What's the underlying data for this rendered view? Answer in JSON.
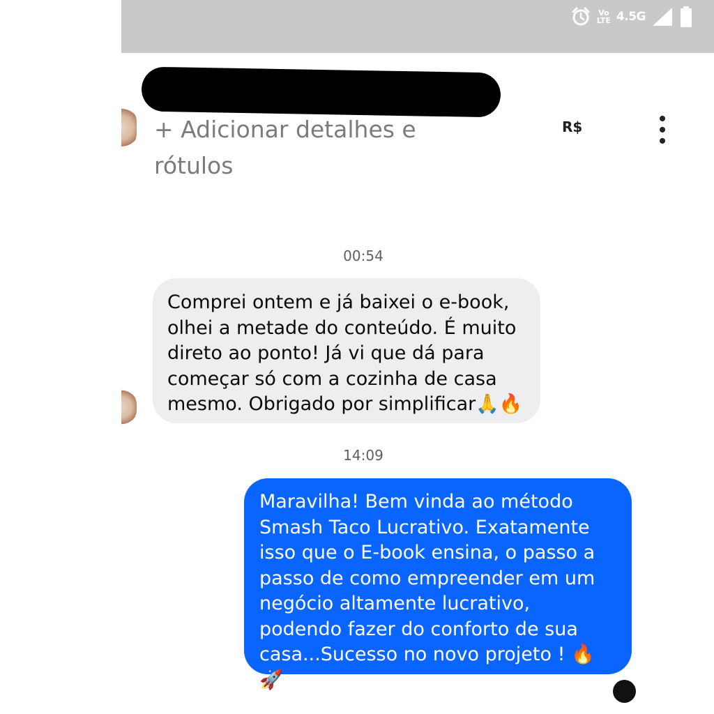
{
  "status_bar": {
    "network": "4.5G",
    "volte": "Vo\nLTE",
    "icons": [
      "alarm-icon",
      "volte-icon",
      "signal-icon",
      "battery-icon"
    ]
  },
  "header": {
    "add_details": "+ Adicionar detalhes e\nrótulos",
    "currency_button": "R$",
    "menu_icon": "kebab-menu-icon"
  },
  "messages": [
    {
      "time": "00:54",
      "direction": "incoming",
      "text": "Comprei ontem e já baixei o e-book,\nolhei a metade do conteúdo. É muito\ndireto ao ponto! Já vi que dá para\ncomeçar só com a cozinha de casa\nmesmo. Obrigado por simplificar🙏🔥"
    },
    {
      "time": "14:09",
      "direction": "outgoing",
      "text": "Maravilha! Bem vinda ao método\nSmash Taco Lucrativo. Exatamente\nisso que o E-book ensina, o passo a\npasso de como empreender em um\nnegócio altamente lucrativo,\npodendo fazer do conforto de sua\ncasa...Sucesso no novo projeto ! 🔥🚀"
    }
  ],
  "colors": {
    "status_bar_bg": "#c9c9ca",
    "incoming_bubble": "#eeeef0",
    "outgoing_bubble": "#0a65ff"
  }
}
